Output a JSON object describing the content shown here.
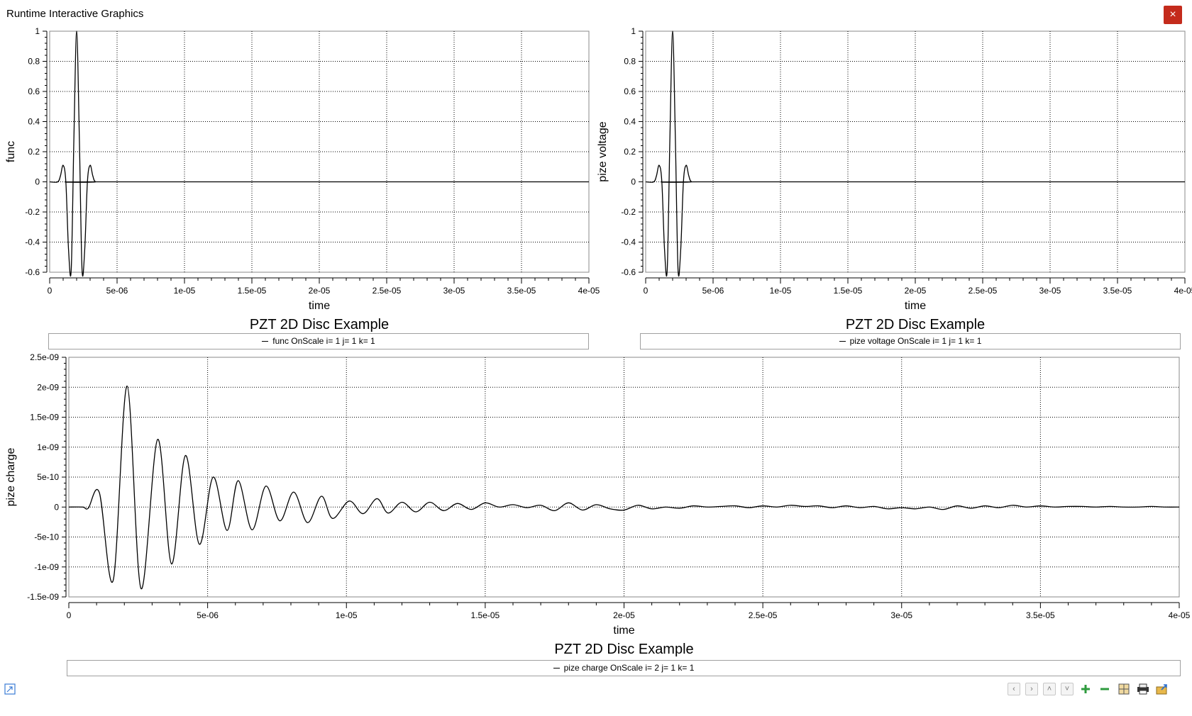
{
  "window": {
    "title": "Runtime Interactive Graphics",
    "close_icon": "×"
  },
  "chart_data": [
    {
      "type": "line",
      "title": "PZT 2D Disc Example",
      "xlabel": "time",
      "ylabel": "func",
      "xlim": [
        0,
        4e-05
      ],
      "ylim": [
        -0.6,
        1
      ],
      "xticks": [
        "0",
        "5e-06",
        "1e-05",
        "1.5e-05",
        "2e-05",
        "2.5e-05",
        "3e-05",
        "3.5e-05",
        "4e-05"
      ],
      "yticks": [
        "-0.6",
        "-0.4",
        "-0.2",
        "0",
        "0.2",
        "0.4",
        "0.6",
        "0.8",
        "1"
      ],
      "grid": true,
      "legend": "bottom",
      "series": [
        {
          "name": "func OnScale i= 1 j= 1 k= 1",
          "x": [
            0,
            6e-07,
            8e-07,
            1e-06,
            1.2e-06,
            1.4e-06,
            1.6e-06,
            1.8e-06,
            2e-06,
            2.2e-06,
            2.4e-06,
            2.6e-06,
            2.8e-06,
            3e-06,
            3.2e-06,
            3.4e-06,
            4e-06,
            4e-05
          ],
          "y": [
            0,
            0,
            0.04,
            0.11,
            0.0,
            -0.45,
            -0.58,
            0.3,
            1.0,
            0.3,
            -0.58,
            -0.45,
            0.0,
            0.11,
            0.04,
            0,
            0,
            0
          ]
        }
      ]
    },
    {
      "type": "line",
      "title": "PZT 2D Disc Example",
      "xlabel": "time",
      "ylabel": "pize voltage",
      "xlim": [
        0,
        4e-05
      ],
      "ylim": [
        -0.6,
        1
      ],
      "xticks": [
        "0",
        "5e-06",
        "1e-05",
        "1.5e-05",
        "2e-05",
        "2.5e-05",
        "3e-05",
        "3.5e-05",
        "4e-05"
      ],
      "yticks": [
        "-0.6",
        "-0.4",
        "-0.2",
        "0",
        "0.2",
        "0.4",
        "0.6",
        "0.8",
        "1"
      ],
      "grid": true,
      "legend": "bottom",
      "series": [
        {
          "name": "pize voltage OnScale i= 1 j= 1 k= 1",
          "x": [
            0,
            6e-07,
            8e-07,
            1e-06,
            1.2e-06,
            1.4e-06,
            1.6e-06,
            1.8e-06,
            2e-06,
            2.2e-06,
            2.4e-06,
            2.6e-06,
            2.8e-06,
            3e-06,
            3.2e-06,
            3.4e-06,
            4e-06,
            4e-05
          ],
          "y": [
            0,
            0,
            0.04,
            0.11,
            0.0,
            -0.45,
            -0.58,
            0.3,
            1.0,
            0.3,
            -0.58,
            -0.45,
            0.0,
            0.11,
            0.04,
            0,
            0,
            0
          ]
        }
      ]
    },
    {
      "type": "line",
      "title": "PZT 2D Disc Example",
      "xlabel": "time",
      "ylabel": "pize charge",
      "xlim": [
        0,
        4e-05
      ],
      "ylim": [
        -1.5e-09,
        2.5e-09
      ],
      "xticks": [
        "0",
        "5e-06",
        "1e-05",
        "1.5e-05",
        "2e-05",
        "2.5e-05",
        "3e-05",
        "3.5e-05",
        "4e-05"
      ],
      "yticks": [
        "-1.5e-09",
        "-1e-09",
        "-5e-10",
        "0",
        "5e-10",
        "1e-09",
        "1.5e-09",
        "2e-09",
        "2.5e-09"
      ],
      "grid": true,
      "legend": "bottom",
      "series": [
        {
          "name": "pize charge OnScale i= 2 j= 1 k= 1",
          "x": [
            0,
            5e-07,
            7e-07,
            1.1e-06,
            1.6e-06,
            2.1e-06,
            2.6e-06,
            3.2e-06,
            3.7e-06,
            4.2e-06,
            4.7e-06,
            5.2e-06,
            5.7e-06,
            6.1e-06,
            6.6e-06,
            7.1e-06,
            7.6e-06,
            8.1e-06,
            8.6e-06,
            9.1e-06,
            9.5e-06,
            1.01e-05,
            1.06e-05,
            1.11e-05,
            1.15e-05,
            1.2e-05,
            1.25e-05,
            1.3e-05,
            1.35e-05,
            1.4e-05,
            1.45e-05,
            1.5e-05,
            1.55e-05,
            1.6e-05,
            1.65e-05,
            1.7e-05,
            1.75e-05,
            1.8e-05,
            1.85e-05,
            1.9e-05,
            1.95e-05,
            2e-05,
            2.05e-05,
            2.1e-05,
            2.15e-05,
            2.2e-05,
            2.25e-05,
            2.3e-05,
            2.35e-05,
            2.4e-05,
            2.45e-05,
            2.5e-05,
            2.55e-05,
            2.6e-05,
            2.65e-05,
            2.7e-05,
            2.75e-05,
            2.8e-05,
            2.85e-05,
            2.9e-05,
            2.95e-05,
            3e-05,
            3.05e-05,
            3.1e-05,
            3.15e-05,
            3.2e-05,
            3.25e-05,
            3.3e-05,
            3.35e-05,
            3.4e-05,
            3.45e-05,
            3.5e-05,
            3.55e-05,
            3.6e-05,
            3.65e-05,
            3.7e-05,
            3.75e-05,
            3.8e-05,
            3.85e-05,
            3.9e-05,
            3.95e-05,
            4e-05
          ],
          "y": [
            0,
            0,
            -2e-11,
            2.4e-10,
            -1.22e-09,
            2.02e-09,
            -1.36e-09,
            1.13e-09,
            -9.5e-10,
            8.6e-10,
            -6.2e-10,
            5e-10,
            -3.9e-10,
            4.4e-10,
            -3.8e-10,
            3.5e-10,
            -2.3e-10,
            2.5e-10,
            -2.6e-10,
            1.8e-10,
            -1.9e-10,
            1e-10,
            -1.1e-10,
            1.4e-10,
            -1e-10,
            8e-11,
            -8e-11,
            8e-11,
            -6e-11,
            6e-11,
            -4e-11,
            7e-11,
            0,
            4e-11,
            -1e-11,
            3e-11,
            -6e-11,
            7e-11,
            -5e-11,
            4e-11,
            -3e-11,
            -5e-11,
            3e-11,
            -3e-11,
            0,
            -2e-11,
            2e-11,
            0,
            1e-11,
            2e-11,
            -1e-11,
            2e-11,
            0,
            3e-11,
            1e-11,
            2e-11,
            -1e-11,
            2e-11,
            -1e-11,
            1e-11,
            -3e-11,
            -1e-11,
            -3e-11,
            0,
            -4e-11,
            2e-11,
            -2e-11,
            2e-11,
            -1e-11,
            3e-11,
            0,
            2e-11,
            0,
            1e-11,
            1e-11,
            0,
            1e-11,
            0,
            0,
            1e-11,
            0,
            0
          ]
        }
      ]
    }
  ],
  "toolbar": {
    "buttons": [
      {
        "name": "left-arrow-icon",
        "glyph": "‹"
      },
      {
        "name": "right-arrow-icon",
        "glyph": "›"
      },
      {
        "name": "up-arrow-icon",
        "glyph": "˄"
      },
      {
        "name": "down-arrow-icon",
        "glyph": "˅"
      },
      {
        "name": "zoom-in-icon"
      },
      {
        "name": "zoom-out-icon"
      },
      {
        "name": "fit-view-icon"
      },
      {
        "name": "print-icon"
      },
      {
        "name": "export-icon"
      }
    ]
  },
  "colors": {
    "close_button": "#c42b1c",
    "zoom_green": "#2e9b3e",
    "grid": "#000000",
    "line": "#000000"
  }
}
